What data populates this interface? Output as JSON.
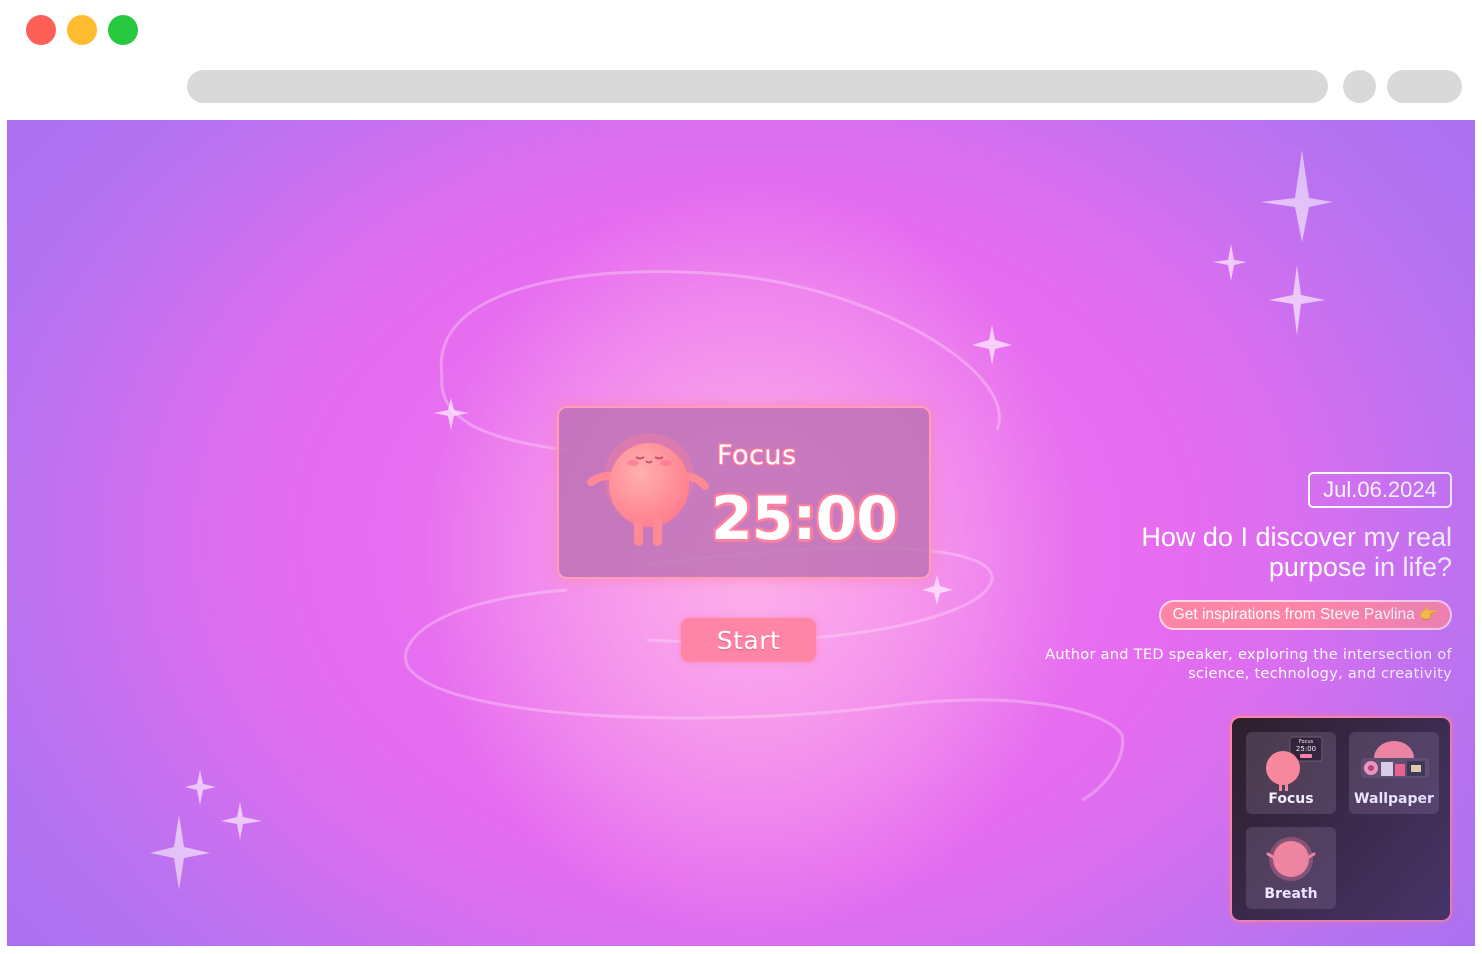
{
  "browser": {
    "window_controls": [
      "close",
      "minimize",
      "maximize"
    ]
  },
  "timer": {
    "mode_label": "Focus",
    "time": "25:00",
    "start_label": "Start"
  },
  "quote": {
    "date": "Jul.06.2024",
    "question": "How do I discover my real purpose in life?",
    "link_label": "Get inspirations from Steve Pavlina 👉",
    "author_description": "Author and TED speaker, exploring the intersection of science, technology, and creativity"
  },
  "launcher": {
    "apps": [
      {
        "label": "Focus",
        "mini_mode": "Focus",
        "mini_time": "25:00"
      },
      {
        "label": "Wallpaper"
      },
      {
        "label": "Breath"
      }
    ]
  },
  "colors": {
    "accent_pink": "#ff85a6",
    "background_magenta": "#e56bf0",
    "launcher_bg": "#2d1f2d"
  }
}
